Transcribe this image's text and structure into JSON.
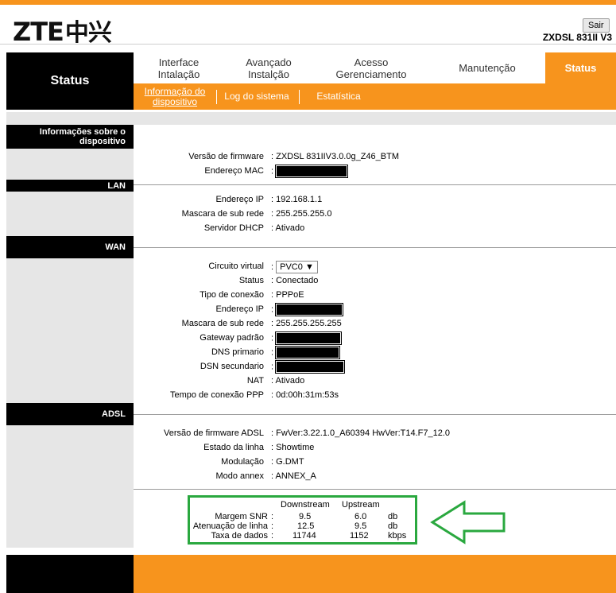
{
  "brand": {
    "logo_text": "ZTE",
    "logo_cn": "中兴",
    "model": "ZXDSL 831II V3",
    "logout_label": "Sair"
  },
  "nav": {
    "page_title": "Status",
    "tabs": [
      {
        "label": "Interface Intalação"
      },
      {
        "label": "Avançado Instalção"
      },
      {
        "label": "Acesso Gerenciamento"
      },
      {
        "label": "Manutenção"
      },
      {
        "label": "Status"
      }
    ],
    "subtabs": [
      {
        "label": "Informação do dispositivo"
      },
      {
        "label": "Log do sistema"
      },
      {
        "label": "Estatística"
      }
    ]
  },
  "sections": {
    "device": {
      "title": "Informações sobre o dispositivo",
      "firmware_label": "Versão de firmware",
      "firmware_value": ": ZXDSL 831IIV3.0.0g_Z46_BTM",
      "mac_label": "Endereço MAC",
      "mac_sep": ":"
    },
    "lan": {
      "title": "LAN",
      "ip_label": "Endereço IP",
      "ip_value": ": 192.168.1.1",
      "mask_label": "Mascara de sub rede",
      "mask_value": ": 255.255.255.0",
      "dhcp_label": "Servidor DHCP",
      "dhcp_value": ": Ativado"
    },
    "wan": {
      "title": "WAN",
      "vc_label": "Circuito virtual",
      "vc_sep": ":",
      "vc_value": "PVC0",
      "status_label": "Status",
      "status_value": ": Conectado",
      "conn_type_label": "Tipo de conexão",
      "conn_type_value": ": PPPoE",
      "ip_label": "Endereço IP",
      "ip_sep": ":",
      "mask_label": "Mascara de sub rede",
      "mask_value": ": 255.255.255.255",
      "gateway_label": "Gateway padrão",
      "gateway_sep": ":",
      "dns1_label": "DNS primario",
      "dns1_sep": ":",
      "dns2_label": "DSN secundario",
      "dns2_sep": ":",
      "nat_label": "NAT",
      "nat_value": ": Ativado",
      "ppp_time_label": "Tempo de conexão PPP",
      "ppp_time_value": ": 0d:00h:31m:53s"
    },
    "adsl": {
      "title": "ADSL",
      "fw_label": "Versão de firmware ADSL",
      "fw_value": ": FwVer:3.22.1.0_A60394 HwVer:T14.F7_12.0",
      "line_label": "Estado da linha",
      "line_value": ": Showtime",
      "mod_label": "Modulação",
      "mod_value": ": G.DMT",
      "annex_label": "Modo annex",
      "annex_value": ": ANNEX_A"
    }
  },
  "stats": {
    "col_down": "Downstream",
    "col_up": "Upstream",
    "rows": [
      {
        "label": "Margem SNR",
        "sep": ":",
        "down": "9.5",
        "up": "6.0",
        "unit": "db"
      },
      {
        "label": "Atenuação de linha",
        "sep": ":",
        "down": "12.5",
        "up": "9.5",
        "unit": "db"
      },
      {
        "label": "Taxa de dados",
        "sep": ":",
        "down": "11744",
        "up": "1152",
        "unit": "kbps"
      }
    ]
  },
  "colors": {
    "accent": "#f7941d",
    "highlight": "#2aa83f"
  }
}
